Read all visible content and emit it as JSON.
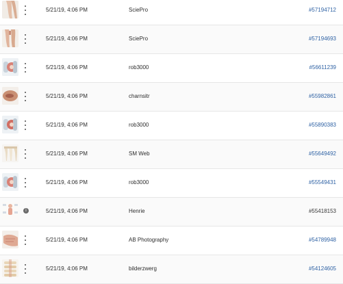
{
  "rows": [
    {
      "thumb": "leg-anatomy-thumbnail",
      "menu": "more-menu-icon",
      "date": "5/21/19, 4:06 PM",
      "author": "SciePro",
      "id": "#57194712",
      "link": true
    },
    {
      "thumb": "legs-anatomy-thumbnail",
      "menu": "more-menu-icon",
      "date": "5/21/19, 4:06 PM",
      "author": "SciePro",
      "id": "#57194693",
      "link": true
    },
    {
      "thumb": "knee-joint-thumbnail",
      "menu": "more-menu-icon",
      "date": "5/21/19, 4:06 PM",
      "author": "rob3000",
      "id": "#56611239",
      "link": true
    },
    {
      "thumb": "skin-closeup-thumbnail",
      "menu": "more-menu-icon",
      "date": "5/21/19, 4:06 PM",
      "author": "charnsitr",
      "id": "#55982861",
      "link": true
    },
    {
      "thumb": "knee-joint-thumbnail",
      "menu": "more-menu-icon",
      "date": "5/21/19, 4:06 PM",
      "author": "rob3000",
      "id": "#55890383",
      "link": true
    },
    {
      "thumb": "teeth-thumbnail",
      "menu": "more-menu-icon",
      "date": "5/21/19, 4:06 PM",
      "author": "SM Web",
      "id": "#55649492",
      "link": true
    },
    {
      "thumb": "knee-joint-thumbnail",
      "menu": "more-menu-icon",
      "date": "5/21/19, 4:06 PM",
      "author": "rob3000",
      "id": "#55549431",
      "link": true
    },
    {
      "thumb": "anatomy-chart-thumbnail",
      "menu": "info-icon",
      "date": "5/21/19, 4:06 PM",
      "author": "Henrie",
      "id": "#55418153",
      "link": false
    },
    {
      "thumb": "hand-thumbnail",
      "menu": "more-menu-icon",
      "date": "5/21/19, 4:06 PM",
      "author": "AB Photography",
      "id": "#54789948",
      "link": true
    },
    {
      "thumb": "spine-thumbnail",
      "menu": "more-menu-icon",
      "date": "5/21/19, 4:06 PM",
      "author": "bilderzwerg",
      "id": "#54124605",
      "link": true
    }
  ],
  "colors": {
    "link": "#2f62a4",
    "divider": "#e6e6e6"
  }
}
